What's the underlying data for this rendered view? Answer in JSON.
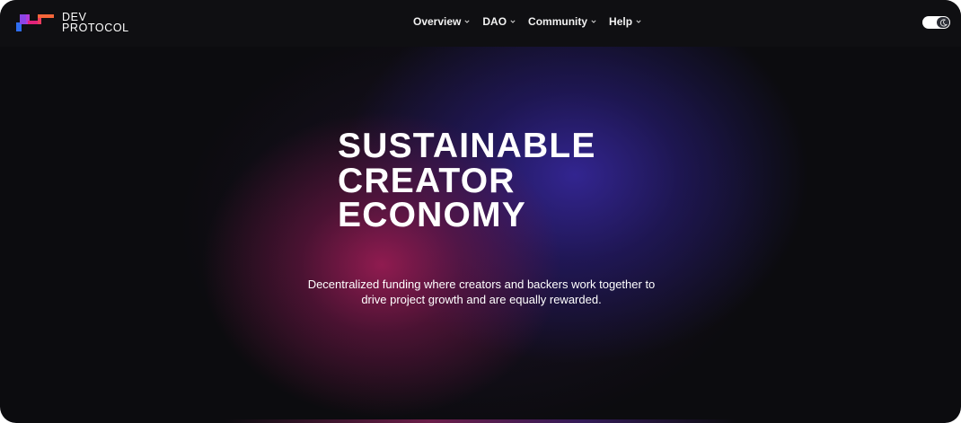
{
  "brand": {
    "line1": "DEV",
    "line2": "PROTOCOL",
    "colors": {
      "magenta": "#e0227a",
      "orange": "#f5663a",
      "purple": "#8b45e6",
      "blue": "#2e6df0"
    }
  },
  "nav": {
    "items": [
      {
        "label": "Overview",
        "icon": "chevron-down-icon"
      },
      {
        "label": "DAO",
        "icon": "chevron-down-icon"
      },
      {
        "label": "Community",
        "icon": "chevron-down-icon"
      },
      {
        "label": "Help",
        "icon": "chevron-down-icon"
      }
    ]
  },
  "theme_toggle": {
    "icon": "moon-icon",
    "state": "dark"
  },
  "hero": {
    "title_lines": [
      "SUSTAINABLE",
      "CREATOR",
      "ECONOMY"
    ],
    "subtitle_lines": [
      "Decentralized funding where creators and backers work together to",
      "drive project growth and are equally rewarded."
    ]
  },
  "colors": {
    "background": "#0c0c0f",
    "glow_pink": "#961c52",
    "glow_blue": "#34269a",
    "text": "#ffffff"
  }
}
